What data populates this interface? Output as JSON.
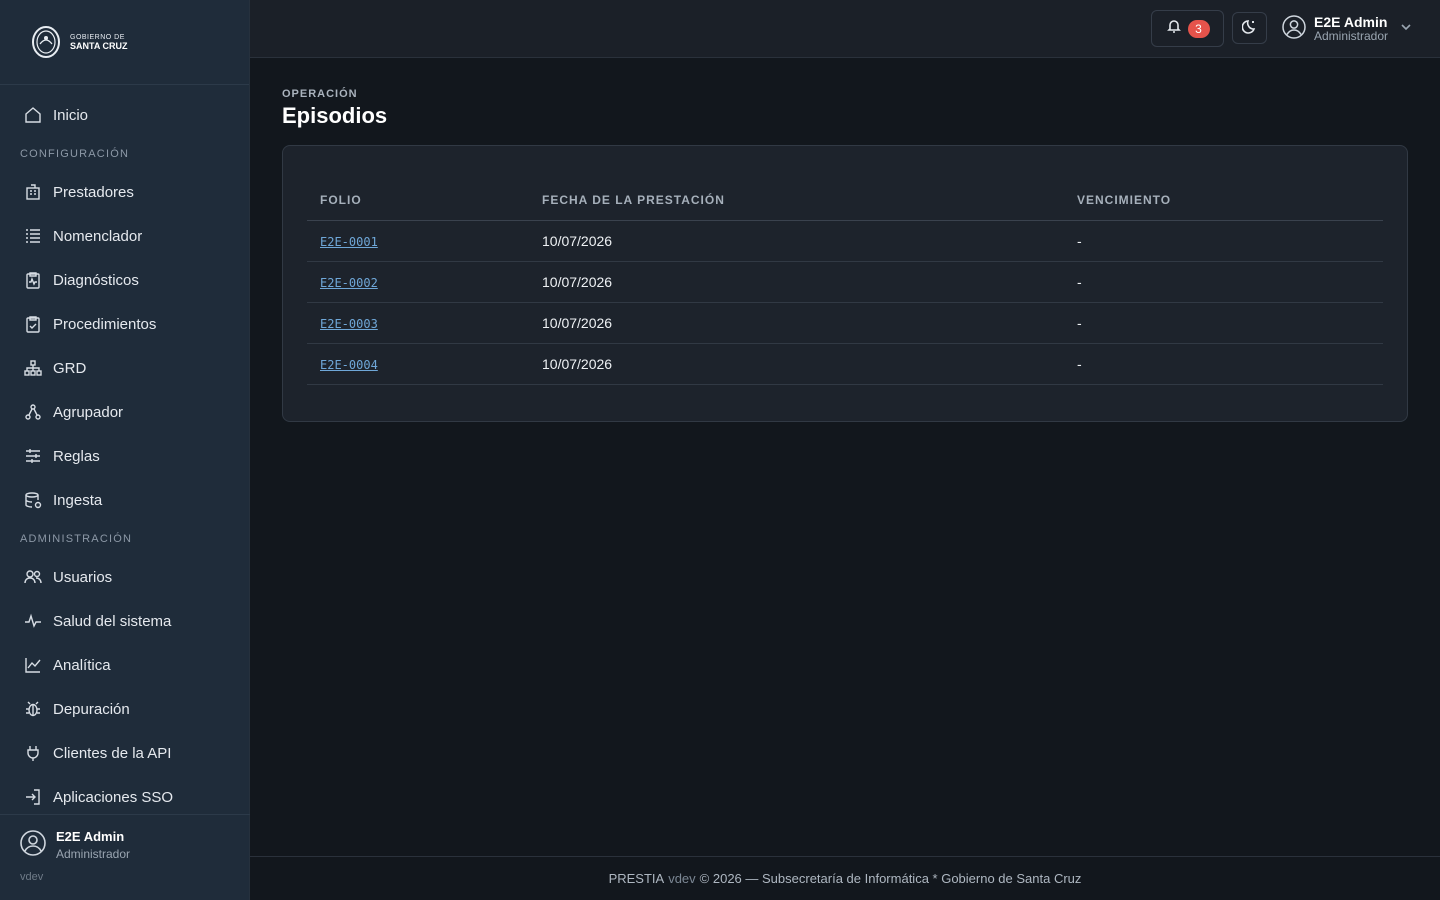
{
  "brand": {
    "logo_line1": "GOBIERNO DE",
    "logo_line2": "SANTA CRUZ"
  },
  "sidebar": {
    "top_items": [
      {
        "label": "Inicio",
        "icon": "home-icon"
      }
    ],
    "sections": [
      {
        "title": "CONFIGURACIÓN",
        "items": [
          {
            "label": "Prestadores",
            "icon": "building-icon"
          },
          {
            "label": "Nomenclador",
            "icon": "list-icon"
          },
          {
            "label": "Diagnósticos",
            "icon": "clipboard-pulse-icon"
          },
          {
            "label": "Procedimientos",
            "icon": "clipboard-check-icon"
          },
          {
            "label": "GRD",
            "icon": "hierarchy-icon"
          },
          {
            "label": "Agrupador",
            "icon": "nodes-icon"
          },
          {
            "label": "Reglas",
            "icon": "sliders-icon"
          },
          {
            "label": "Ingesta",
            "icon": "database-icon"
          }
        ]
      },
      {
        "title": "ADMINISTRACIÓN",
        "items": [
          {
            "label": "Usuarios",
            "icon": "users-icon"
          },
          {
            "label": "Salud del sistema",
            "icon": "pulse-icon"
          },
          {
            "label": "Analítica",
            "icon": "chart-line-icon"
          },
          {
            "label": "Depuración",
            "icon": "bug-icon"
          },
          {
            "label": "Clientes de la API",
            "icon": "plug-icon"
          },
          {
            "label": "Aplicaciones SSO",
            "icon": "sign-in-icon"
          }
        ]
      }
    ],
    "user": {
      "name": "E2E Admin",
      "role": "Administrador",
      "version": "vdev"
    }
  },
  "topbar": {
    "notifications_count": "3",
    "user_name": "E2E Admin",
    "user_role": "Administrador"
  },
  "page": {
    "eyebrow": "OPERACIÓN",
    "title": "Episodios"
  },
  "table": {
    "headers": {
      "folio": "FOLIO",
      "fecha": "FECHA DE LA PRESTACIÓN",
      "vencimiento": "VENCIMIENTO"
    },
    "rows": [
      {
        "folio": "E2E-0001",
        "fecha": "10/07/2026",
        "vencimiento": "-"
      },
      {
        "folio": "E2E-0002",
        "fecha": "10/07/2026",
        "vencimiento": "-"
      },
      {
        "folio": "E2E-0003",
        "fecha": "10/07/2026",
        "vencimiento": "-"
      },
      {
        "folio": "E2E-0004",
        "fecha": "10/07/2026",
        "vencimiento": "-"
      }
    ]
  },
  "footer": {
    "product": "PRESTIA",
    "version": "vdev",
    "rest": "© 2026 — Subsecretaría de Informática * Gobierno de Santa Cruz"
  },
  "colors": {
    "sidebar_bg": "#1f2c3a",
    "main_bg": "#12171d",
    "link": "#6fa7d8",
    "badge": "#e5534b"
  }
}
